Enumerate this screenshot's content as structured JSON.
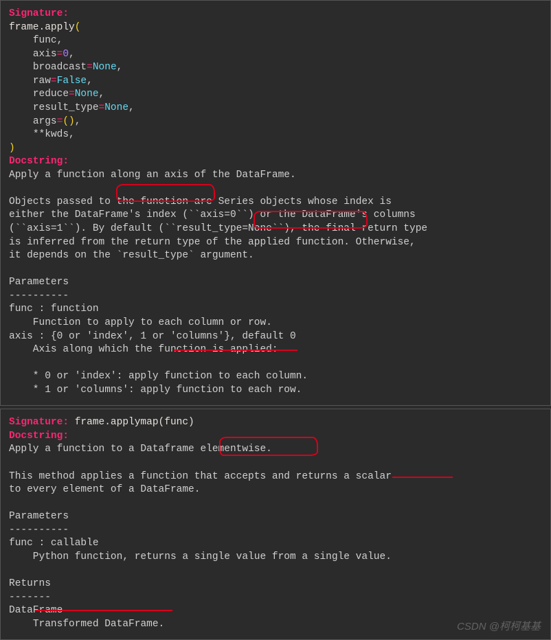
{
  "panel1": {
    "sig_label": "Signature:",
    "sig_line0": "frame.apply",
    "p_open": "(",
    "args": {
      "a0": "func",
      "a1_name": "axis",
      "a1_eq": "=",
      "a1_val": "0",
      "a2_name": "broadcast",
      "a2_eq": "=",
      "a2_val": "None",
      "a3_name": "raw",
      "a3_eq": "=",
      "a3_val": "False",
      "a4_name": "reduce",
      "a4_eq": "=",
      "a4_val": "None",
      "a5_name": "result_type",
      "a5_eq": "=",
      "a5_val": "None",
      "a6_name": "args",
      "a6_eq": "=",
      "a6_val": "()",
      "a7": "**kwds"
    },
    "p_close": ")",
    "doc_label": "Docstring:",
    "doc_l1a": "Apply a function ",
    "doc_l1b": "along an axis ",
    "doc_l1c": "of the DataFrame.",
    "doc_l3a": "Objects passed to the function are ",
    "doc_l3b": "Series objects ",
    "doc_l3c": "whose index is",
    "doc_l4": "either the DataFrame's index (``axis=0``) or the DataFrame's columns",
    "doc_l5": "(``axis=1``). By default (``result_type=None``), the final return type",
    "doc_l6": "is inferred from the return type of the applied function. Otherwise,",
    "doc_l7": "it depends on the `result_type` argument.",
    "params_hdr": "Parameters",
    "params_rule": "----------",
    "p_func": "func : function",
    "p_func_desc_a": "    Function to apply to ",
    "p_func_desc_b": "each column or row",
    "p_func_desc_c": ".",
    "p_axis": "axis : {0 or 'index', 1 or 'columns'}, default 0",
    "p_axis_desc": "    Axis along which the function is applied:",
    "bullet0": "    * 0 or 'index': apply function to each column.",
    "bullet1": "    * 1 or 'columns': apply function to each row."
  },
  "panel2": {
    "sig_label": "Signature:",
    "sig_text": " frame.applymap(func)",
    "doc_label": "Docstring:",
    "doc_l1a": "Apply a function to a Dataframe ",
    "doc_l1b": "elementwise.",
    "doc_l3a": "This method applies a function that accepts and returns ",
    "doc_l3b": "a scalar",
    "doc_l4": "to every element of a DataFrame.",
    "params_hdr": "Parameters",
    "params_rule": "----------",
    "p_func": "func : callable",
    "p_func_desc": "    Python function, returns a single value from a single value.",
    "ret_hdr": "Returns",
    "ret_rule": "-------",
    "ret_type": "DataFrame",
    "ret_desc_a": "    ",
    "ret_desc_b": "Transformed DataFrame."
  },
  "watermark": "CSDN @柯柯基基"
}
